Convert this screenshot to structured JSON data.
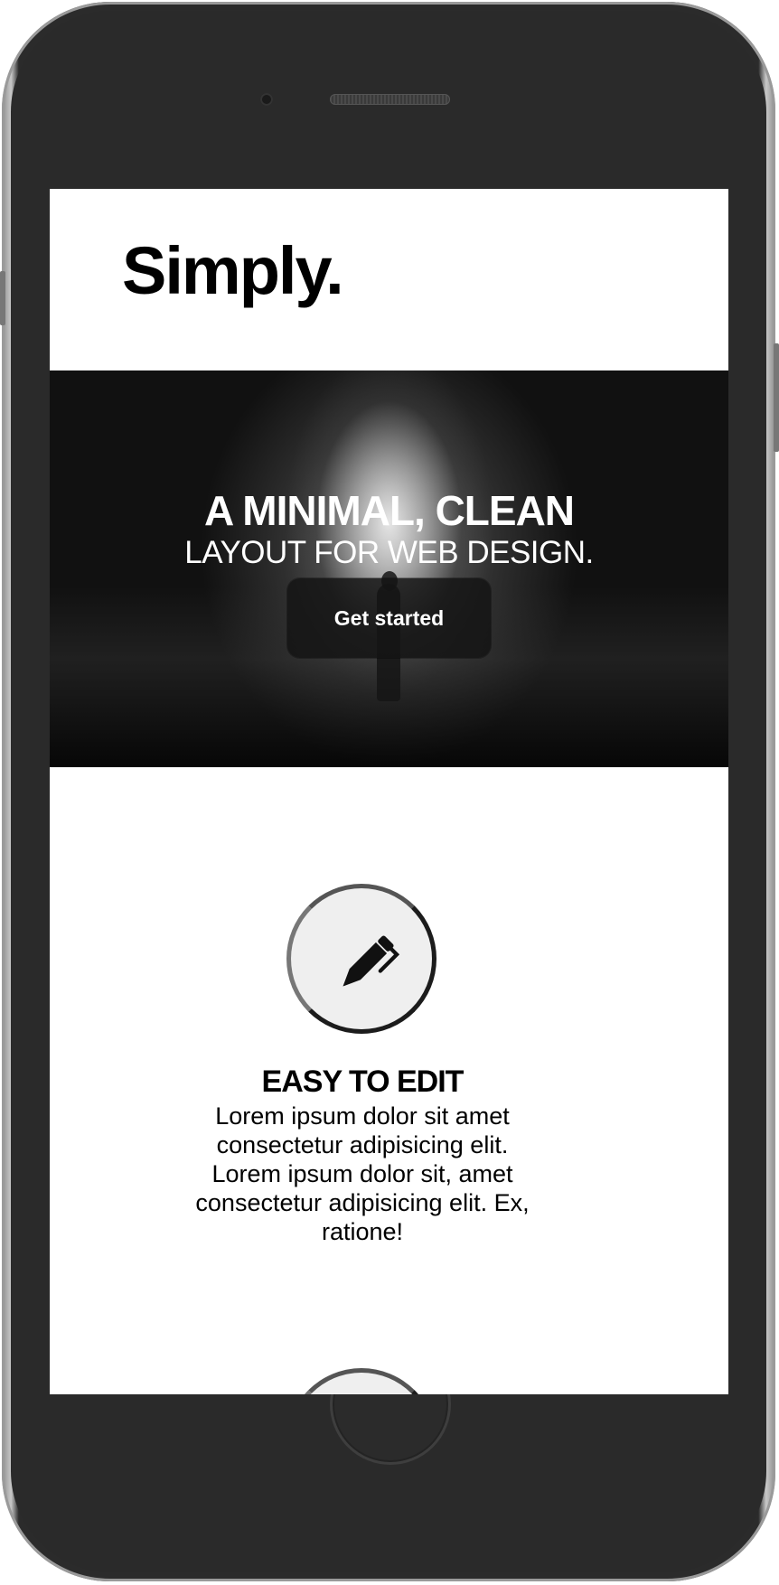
{
  "site": {
    "logo": "Simply."
  },
  "hero": {
    "title": "A MINIMAL, CLEAN",
    "subtitle": "LAYOUT FOR WEB DESIGN.",
    "cta_label": "Get started"
  },
  "feature": {
    "icon": "pen-icon",
    "title": "EASY TO EDIT",
    "text": "Lorem ipsum dolor sit amet consectetur adipisicing elit. Lorem ipsum dolor sit, amet consectetur adipisicing elit. Ex, ratione!"
  },
  "colors": {
    "device_body": "#2b2b2b",
    "screen_bg": "#ffffff",
    "text": "#000000",
    "hero_text": "#ffffff",
    "icon_circle_bg": "#efefef"
  }
}
